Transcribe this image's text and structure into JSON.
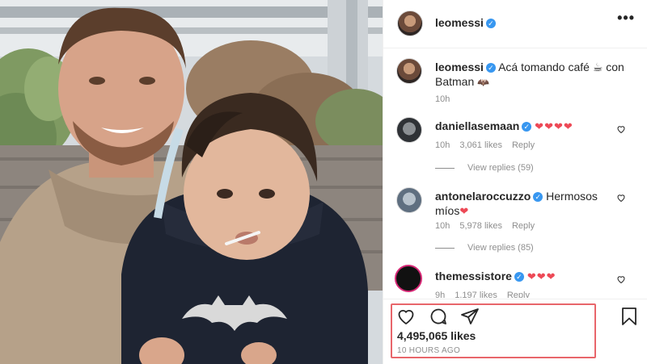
{
  "post": {
    "username": "leomessi",
    "caption_text": "Acá tomando café",
    "caption_suffix": "con",
    "caption_line2": "Batman",
    "caption_time": "10h",
    "likes": "4,495,065 likes",
    "time_ago": "10 HOURS AGO"
  },
  "comments": [
    {
      "username": "daniellasemaan",
      "text": "❤❤❤❤",
      "time": "10h",
      "likes": "3,061 likes",
      "reply_label": "Reply",
      "view_replies": "View replies (59)"
    },
    {
      "username": "antonelaroccuzzo",
      "text_line1": "Hermosos",
      "text_line2": "míos",
      "text_emoji": "❤",
      "time": "10h",
      "likes": "5,978 likes",
      "reply_label": "Reply",
      "view_replies": "View replies (85)"
    },
    {
      "username": "themessistore",
      "text": "❤❤❤",
      "time": "9h",
      "likes": "1,197 likes",
      "reply_label": "Reply"
    }
  ],
  "icons": {
    "verified": "verified-badge-icon",
    "more": "more-options-icon",
    "like": "heart-icon",
    "comment": "comment-icon",
    "share": "share-icon",
    "save": "bookmark-icon"
  },
  "colors": {
    "verified": "#3897f0",
    "heart": "#ed4956",
    "highlight_box": "#e8666b",
    "muted_text": "#8e8e8e"
  }
}
